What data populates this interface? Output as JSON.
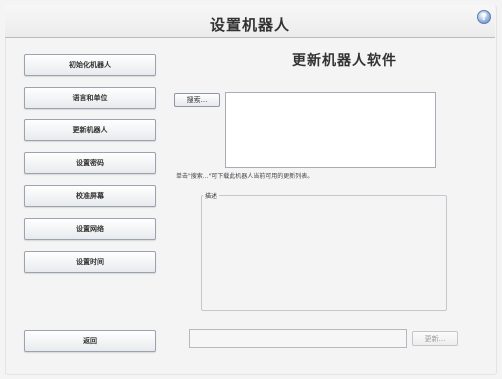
{
  "window": {
    "title": "设置机器人",
    "help_label": "?"
  },
  "sidebar": {
    "items": [
      {
        "label": "初始化机器人"
      },
      {
        "label": "语言和单位"
      },
      {
        "label": "更新机器人"
      },
      {
        "label": "设置密码"
      },
      {
        "label": "校准屏幕"
      },
      {
        "label": "设置网络"
      },
      {
        "label": "设置时间"
      }
    ],
    "back_label": "返回"
  },
  "main": {
    "heading": "更新机器人软件",
    "search_label": "搜索...",
    "hint": "单击\"搜索...\"可下载此机器人当前可用的更新列表。",
    "description_label": "描述",
    "status_value": "",
    "update_label": "更新..."
  }
}
